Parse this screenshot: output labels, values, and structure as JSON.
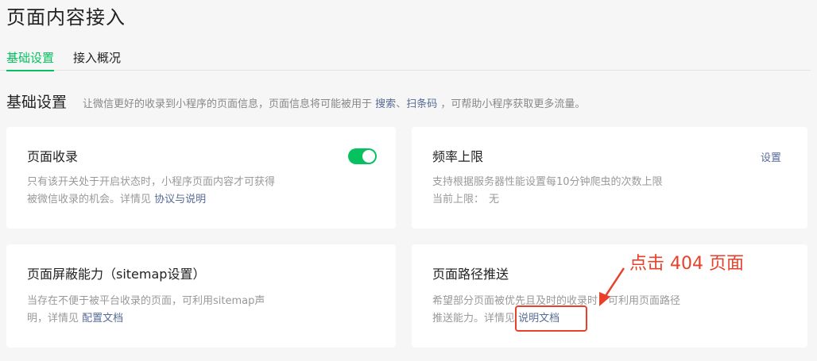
{
  "header": {
    "title": "页面内容接入"
  },
  "tabs": [
    {
      "label": "基础设置",
      "active": true
    },
    {
      "label": "接入概况",
      "active": false
    }
  ],
  "section": {
    "title": "基础设置",
    "desc_prefix": "让微信更好的收录到小程序的页面信息，页面信息将可能被用于",
    "desc_link1": "搜索",
    "desc_sep": "、",
    "desc_link2": "扫条码",
    "desc_suffix": "，可帮助小程序获取更多流量。"
  },
  "cards": {
    "page_index": {
      "title": "页面收录",
      "desc_line1": "只有该开关处于开启状态时，小程序页面内容才可获得",
      "desc_line2_prefix": "被微信收录的机会。详情见",
      "link": "协议与说明",
      "toggle_on": true
    },
    "rate_limit": {
      "title": "频率上限",
      "settings": "设置",
      "desc_line1": "支持根据服务器性能设置每10分钟爬虫的次数上限",
      "current_label": "当前上限：",
      "current_value": "无"
    },
    "sitemap": {
      "title": "页面屏蔽能力（sitemap设置）",
      "desc_line1": "当存在不便于被平台收录的页面，可利用sitemap声",
      "desc_line2_prefix": "明，详情见",
      "link": "配置文档"
    },
    "path_push": {
      "title": "页面路径推送",
      "desc_line1": "希望部分页面被优先且及时的收录时，可利用页面路径",
      "desc_line2_prefix": "推送能力。详情见",
      "link": "说明文档"
    }
  },
  "annotation": {
    "text": "点击 404 页面"
  },
  "colors": {
    "accent": "#07c160",
    "link": "#576b95",
    "annotation": "#e8402a"
  }
}
